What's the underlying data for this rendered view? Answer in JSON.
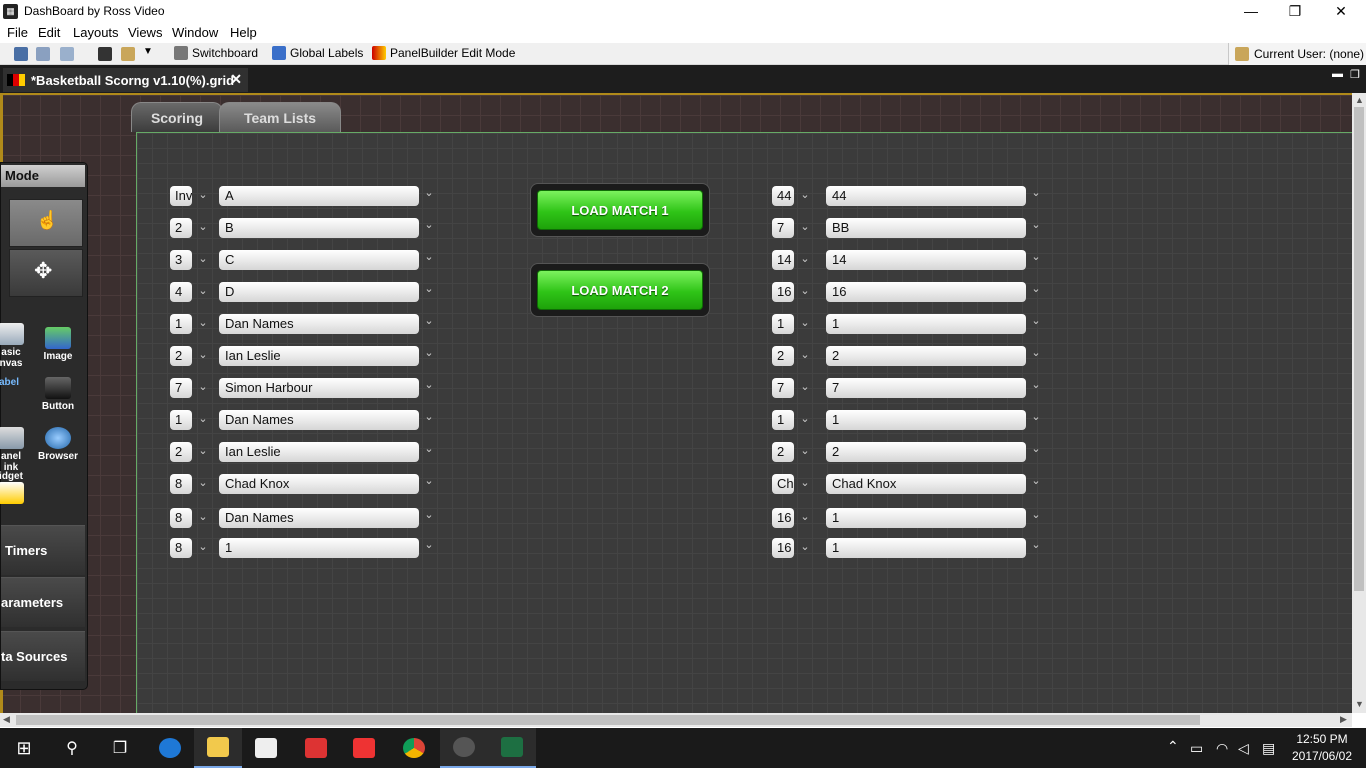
{
  "window": {
    "title": "DashBoard by Ross Video",
    "minimize": "—",
    "maximize": "❐",
    "close": "✕"
  },
  "menu": [
    "File",
    "Edit",
    "Layouts",
    "Views",
    "Window",
    "Help"
  ],
  "toolbar": {
    "switchboard": "Switchboard",
    "global_labels": "Global Labels",
    "panelbuilder": "PanelBuilder Edit Mode",
    "current_user": "Current User: (none)"
  },
  "doc_tab": {
    "label": "*Basketball Scorng v1.10(%).grid",
    "close": "✕"
  },
  "page_tabs": [
    "Scoring",
    "Team Lists"
  ],
  "palette": {
    "header": "Mode",
    "items": [
      {
        "label1": "asic",
        "label2": "nvas",
        "icon": "basic-canvas-icon"
      },
      {
        "label1": "Image",
        "label2": "",
        "icon": "image-icon"
      },
      {
        "label1": "abel",
        "label2": "",
        "icon": "label-icon"
      },
      {
        "label1": "Button",
        "label2": "",
        "icon": "button-icon"
      },
      {
        "label1": "anel",
        "label2": "ink",
        "icon": "panel-link-icon"
      },
      {
        "label1": "Browser",
        "label2": "",
        "icon": "browser-icon"
      },
      {
        "label1": "idget",
        "label2": "",
        "icon": "widget-icon"
      }
    ],
    "sections": [
      "Timers",
      "arameters",
      "ta Sources"
    ]
  },
  "left_list": [
    {
      "num": "Inv",
      "name": "A"
    },
    {
      "num": "2",
      "name": "B"
    },
    {
      "num": "3",
      "name": "C"
    },
    {
      "num": "4",
      "name": "D"
    },
    {
      "num": "1",
      "name": "Dan Names"
    },
    {
      "num": "2",
      "name": "Ian Leslie"
    },
    {
      "num": "7",
      "name": "Simon Harbour"
    },
    {
      "num": "1",
      "name": "Dan Names"
    },
    {
      "num": "2",
      "name": "Ian Leslie"
    },
    {
      "num": "8",
      "name": "Chad Knox"
    },
    {
      "num": "8",
      "name": "Dan Names"
    },
    {
      "num": "8",
      "name": "1"
    }
  ],
  "right_list": [
    {
      "num": "44",
      "name": "44"
    },
    {
      "num": "7",
      "name": "BB"
    },
    {
      "num": "14",
      "name": "14"
    },
    {
      "num": "16",
      "name": "16"
    },
    {
      "num": "1",
      "name": "1"
    },
    {
      "num": "2",
      "name": "2"
    },
    {
      "num": "7",
      "name": "7"
    },
    {
      "num": "1",
      "name": "1"
    },
    {
      "num": "2",
      "name": "2"
    },
    {
      "num": "Ch",
      "name": "Chad Knox"
    },
    {
      "num": "16",
      "name": "1"
    },
    {
      "num": "16",
      "name": "1"
    }
  ],
  "buttons": {
    "load1": "LOAD MATCH 1",
    "load2": "LOAD MATCH 2"
  },
  "clock": {
    "time": "12:50 PM",
    "date": "2017/06/02"
  },
  "colors": {
    "accent_green": "#2fc417",
    "canvas_bg": "#3b3b3b",
    "frame_gold": "#b08a1a"
  }
}
